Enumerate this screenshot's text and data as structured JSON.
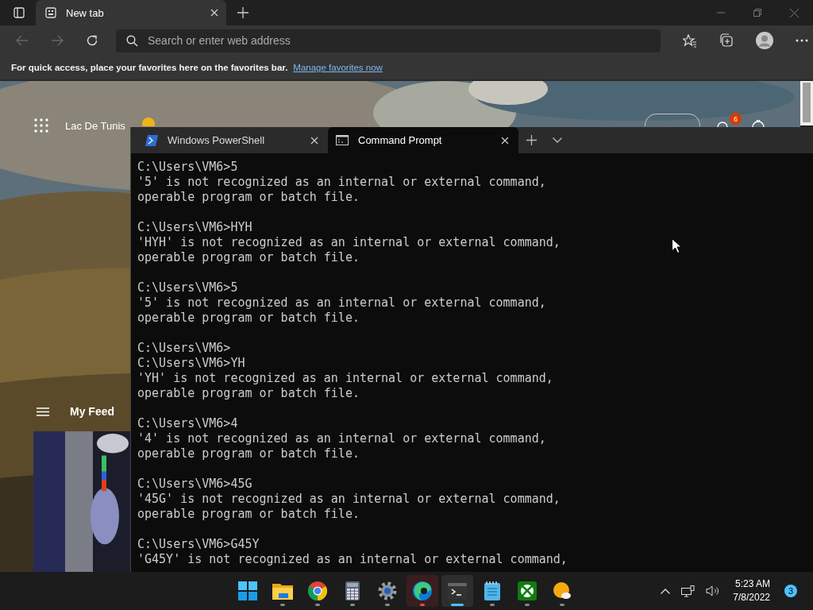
{
  "browser": {
    "tabs": [
      {
        "title": "New tab",
        "selected": true
      }
    ],
    "address_bar": {
      "placeholder": "Search or enter web address"
    },
    "favorites_bar": {
      "message": "For quick access, place your favorites here on the favorites bar.",
      "link": "Manage favorites now"
    },
    "new_tab_page": {
      "location": "Lac De Tunis",
      "notification_count": "6",
      "feed_title": "My Feed"
    }
  },
  "terminal": {
    "tabs": [
      {
        "title": "Windows PowerShell",
        "kind": "powershell",
        "selected": false
      },
      {
        "title": "Command Prompt",
        "kind": "cmd",
        "selected": true
      }
    ],
    "output": [
      {
        "lines": [
          "C:\\Users\\VM6>5",
          "'5' is not recognized as an internal or external command,",
          "operable program or batch file."
        ]
      },
      {
        "lines": [
          "C:\\Users\\VM6>HYH",
          "'HYH' is not recognized as an internal or external command,",
          "operable program or batch file."
        ]
      },
      {
        "lines": [
          "C:\\Users\\VM6>5",
          "'5' is not recognized as an internal or external command,",
          "operable program or batch file."
        ]
      },
      {
        "lines": [
          "C:\\Users\\VM6>",
          "C:\\Users\\VM6>YH",
          "'YH' is not recognized as an internal or external command,",
          "operable program or batch file."
        ]
      },
      {
        "lines": [
          "C:\\Users\\VM6>4",
          "'4' is not recognized as an internal or external command,",
          "operable program or batch file."
        ]
      },
      {
        "lines": [
          "C:\\Users\\VM6>45G",
          "'45G' is not recognized as an internal or external command,",
          "operable program or batch file."
        ]
      },
      {
        "lines": [
          "C:\\Users\\VM6>G45Y",
          "'G45Y' is not recognized as an internal or external command,"
        ]
      }
    ]
  },
  "taskbar": {
    "apps": [
      {
        "kind": "start",
        "running": false,
        "selected": false
      },
      {
        "kind": "folder",
        "running": true,
        "selected": false
      },
      {
        "kind": "chrome",
        "running": true,
        "selected": false
      },
      {
        "kind": "calculator",
        "running": true,
        "selected": false
      },
      {
        "kind": "settings",
        "running": true,
        "selected": false
      },
      {
        "kind": "edge",
        "running": true,
        "selected": false,
        "flashing": true
      },
      {
        "kind": "terminal",
        "running": true,
        "selected": true
      },
      {
        "kind": "notepad",
        "running": true,
        "selected": false
      },
      {
        "kind": "xbox",
        "running": true,
        "selected": false
      },
      {
        "kind": "weather",
        "running": true,
        "selected": false
      }
    ],
    "time": "5:23 AM",
    "date": "7/8/2022",
    "notification_count": "3"
  }
}
